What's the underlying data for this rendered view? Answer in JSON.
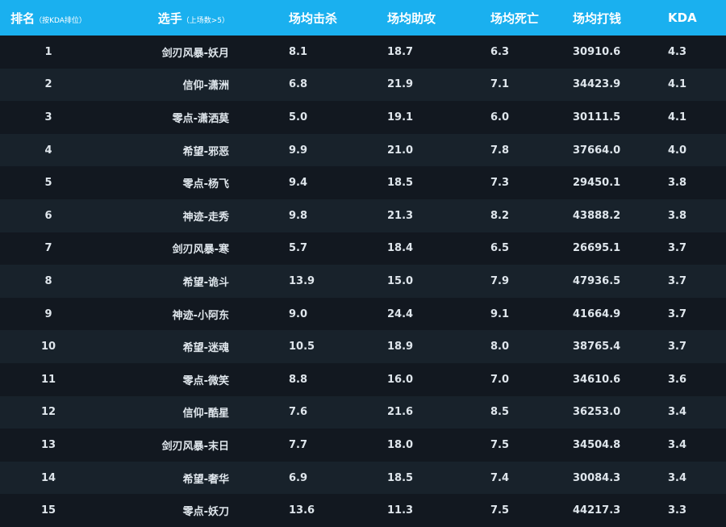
{
  "table": {
    "headers": {
      "rank": "排名",
      "rank_note": "（按KDA排位）",
      "player": "选手",
      "player_note": "（上场数>5）",
      "kills": "场均击杀",
      "assists": "场均助攻",
      "deaths": "场均死亡",
      "gold": "场均打钱",
      "kda": "KDA"
    },
    "rows": [
      {
        "rank": "1",
        "player": "剑刃风暴-妖月",
        "kills": "8.1",
        "assists": "18.7",
        "deaths": "6.3",
        "gold": "30910.6",
        "kda": "4.3"
      },
      {
        "rank": "2",
        "player": "信仰-潇洲",
        "kills": "6.8",
        "assists": "21.9",
        "deaths": "7.1",
        "gold": "34423.9",
        "kda": "4.1"
      },
      {
        "rank": "3",
        "player": "零点-潇洒莫",
        "kills": "5.0",
        "assists": "19.1",
        "deaths": "6.0",
        "gold": "30111.5",
        "kda": "4.1"
      },
      {
        "rank": "4",
        "player": "希望-邪恶",
        "kills": "9.9",
        "assists": "21.0",
        "deaths": "7.8",
        "gold": "37664.0",
        "kda": "4.0"
      },
      {
        "rank": "5",
        "player": "零点-杨飞",
        "kills": "9.4",
        "assists": "18.5",
        "deaths": "7.3",
        "gold": "29450.1",
        "kda": "3.8"
      },
      {
        "rank": "6",
        "player": "神迹-走秀",
        "kills": "9.8",
        "assists": "21.3",
        "deaths": "8.2",
        "gold": "43888.2",
        "kda": "3.8"
      },
      {
        "rank": "7",
        "player": "剑刃风暴-寒",
        "kills": "5.7",
        "assists": "18.4",
        "deaths": "6.5",
        "gold": "26695.1",
        "kda": "3.7"
      },
      {
        "rank": "8",
        "player": "希望-诡斗",
        "kills": "13.9",
        "assists": "15.0",
        "deaths": "7.9",
        "gold": "47936.5",
        "kda": "3.7"
      },
      {
        "rank": "9",
        "player": "神迹-小阿东",
        "kills": "9.0",
        "assists": "24.4",
        "deaths": "9.1",
        "gold": "41664.9",
        "kda": "3.7"
      },
      {
        "rank": "10",
        "player": "希望-迷魂",
        "kills": "10.5",
        "assists": "18.9",
        "deaths": "8.0",
        "gold": "38765.4",
        "kda": "3.7"
      },
      {
        "rank": "11",
        "player": "零点-微笑",
        "kills": "8.8",
        "assists": "16.0",
        "deaths": "7.0",
        "gold": "34610.6",
        "kda": "3.6"
      },
      {
        "rank": "12",
        "player": "信仰-酷星",
        "kills": "7.6",
        "assists": "21.6",
        "deaths": "8.5",
        "gold": "36253.0",
        "kda": "3.4"
      },
      {
        "rank": "13",
        "player": "剑刃风暴-末日",
        "kills": "7.7",
        "assists": "18.0",
        "deaths": "7.5",
        "gold": "34504.8",
        "kda": "3.4"
      },
      {
        "rank": "14",
        "player": "希望-奢华",
        "kills": "6.9",
        "assists": "18.5",
        "deaths": "7.4",
        "gold": "30084.3",
        "kda": "3.4"
      },
      {
        "rank": "15",
        "player": "零点-妖刀",
        "kills": "13.6",
        "assists": "11.3",
        "deaths": "7.5",
        "gold": "44217.3",
        "kda": "3.3"
      }
    ]
  },
  "colors": {
    "header_bg": "#1ab0ef",
    "row_odd": "#121820",
    "row_even": "#18222b",
    "text": "#dfe6ec"
  }
}
